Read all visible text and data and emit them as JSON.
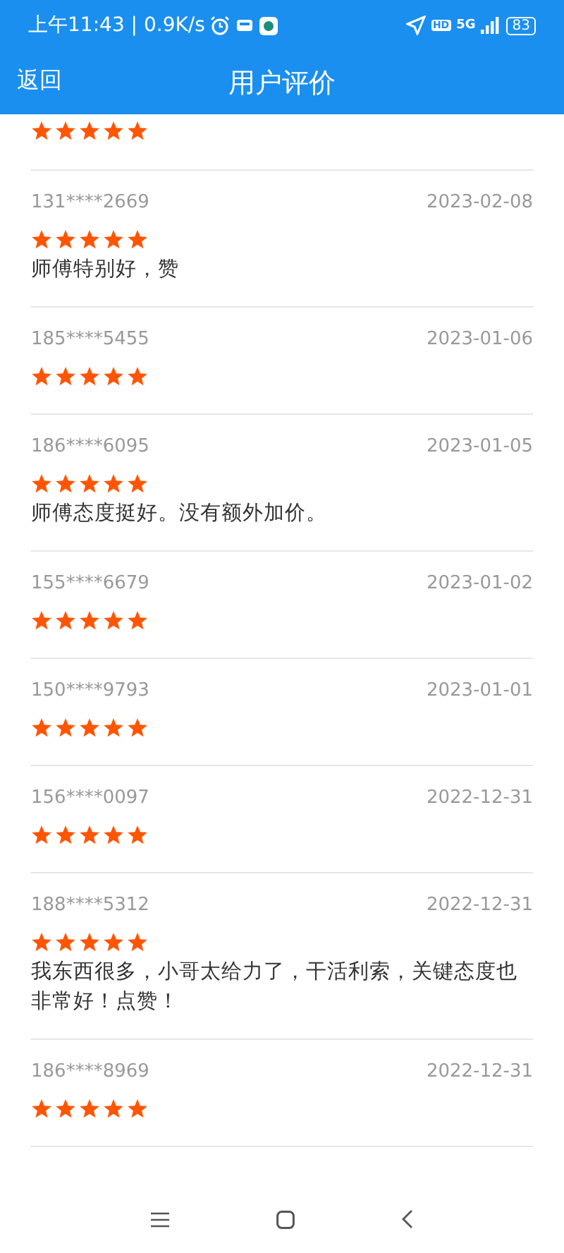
{
  "status_bar": {
    "time_speed": "上午11:43 | 0.9K/s",
    "hd": "HD",
    "network": "5G",
    "battery": "83"
  },
  "header": {
    "back": "返回",
    "title": "用户评价"
  },
  "first_item": {
    "stars": 5
  },
  "reviews": [
    {
      "user": "131****2669",
      "date": "2023-02-08",
      "stars": 5,
      "comment": "师傅特别好，赞"
    },
    {
      "user": "185****5455",
      "date": "2023-01-06",
      "stars": 5
    },
    {
      "user": "186****6095",
      "date": "2023-01-05",
      "stars": 5,
      "comment": "师傅态度挺好。没有额外加价。"
    },
    {
      "user": "155****6679",
      "date": "2023-01-02",
      "stars": 5
    },
    {
      "user": "150****9793",
      "date": "2023-01-01",
      "stars": 5
    },
    {
      "user": "156****0097",
      "date": "2022-12-31",
      "stars": 5
    },
    {
      "user": "188****5312",
      "date": "2022-12-31",
      "stars": 5,
      "comment": "我东西很多，小哥太给力了，干活利索，关键态度也非常好！点赞！"
    },
    {
      "user": "186****8969",
      "date": "2022-12-31",
      "stars": 5
    }
  ]
}
